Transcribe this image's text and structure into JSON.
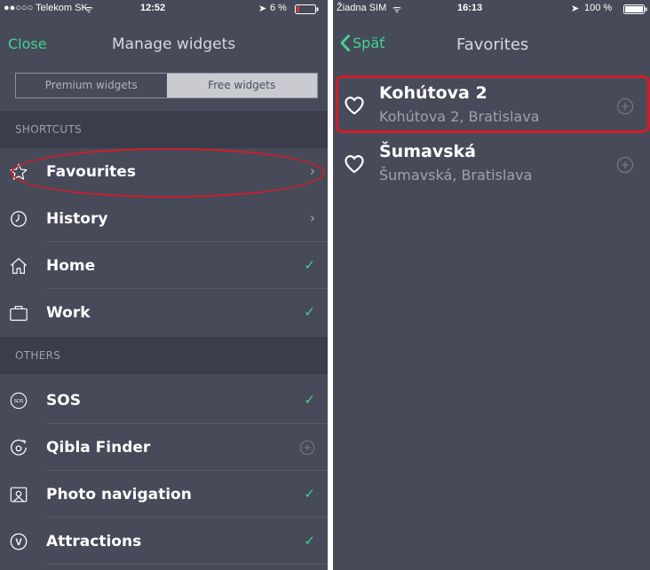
{
  "left": {
    "status": {
      "carrier": "●●○○○ Telekom SK",
      "wifi": "ᯤ",
      "time": "12:52",
      "battery": "6 %"
    },
    "nav": {
      "close": "Close",
      "title": "Manage widgets"
    },
    "segments": [
      "Premium widgets",
      "Free widgets"
    ],
    "sections": [
      {
        "title": "SHORTCUTS"
      },
      {
        "title": "OTHERS"
      }
    ],
    "items": [
      {
        "label": "Favourites",
        "icon": "star-icon",
        "accessory": "chevron"
      },
      {
        "label": "History",
        "icon": "clock-icon",
        "accessory": "chevron"
      },
      {
        "label": "Home",
        "icon": "house-icon",
        "accessory": "check"
      },
      {
        "label": "Work",
        "icon": "briefcase-icon",
        "accessory": "check"
      },
      {
        "label": "SOS",
        "icon": "sos-icon",
        "icon_text": "SOS",
        "accessory": "check"
      },
      {
        "label": "Qibla Finder",
        "icon": "qibla-icon",
        "accessory": "plus"
      },
      {
        "label": "Photo navigation",
        "icon": "photo-icon",
        "accessory": "check"
      },
      {
        "label": "Attractions",
        "icon": "attractions-icon",
        "icon_text": "V",
        "accessory": "check"
      }
    ],
    "glyphs": {
      "chevron": "›",
      "check": "✓"
    }
  },
  "right": {
    "status": {
      "carrier": "Žiadna SIM",
      "wifi": "ᯤ",
      "time": "16:13",
      "battery": "100 %"
    },
    "nav": {
      "back": "Späť",
      "title": "Favorites"
    },
    "favorites": [
      {
        "name": "Kohútova 2",
        "address": "Kohútova 2, Bratislava"
      },
      {
        "name": "Šumavská",
        "address": "Šumavská, Bratislava"
      }
    ]
  },
  "colors": {
    "background": "#464a59",
    "accent": "#42d392",
    "highlight": "#d31c2a"
  }
}
